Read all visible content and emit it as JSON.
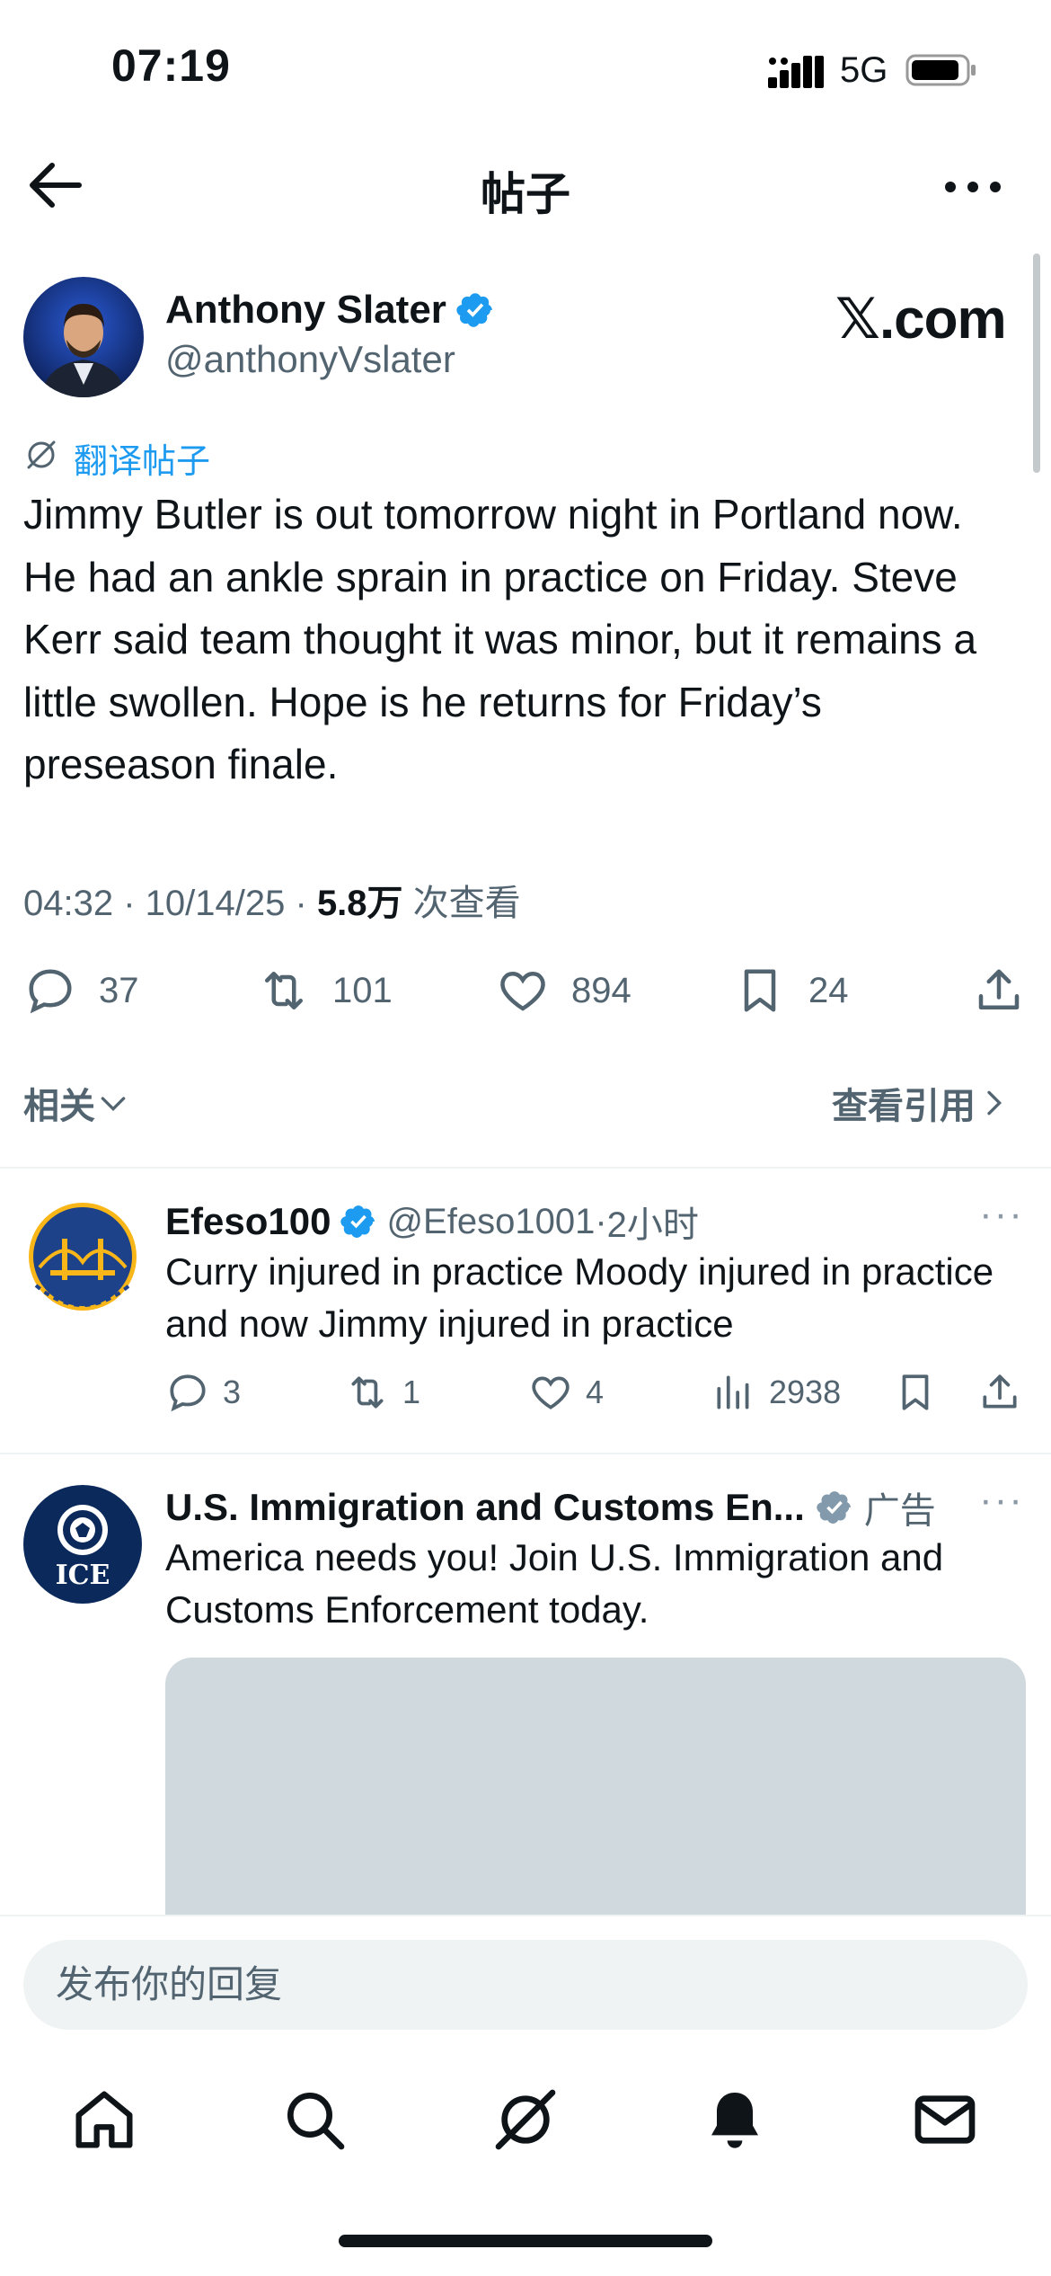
{
  "status_bar": {
    "time": "07:19",
    "network": "5G"
  },
  "nav": {
    "title": "帖子"
  },
  "post": {
    "author_name": "Anthony Slater",
    "author_handle": "@anthonyVslater",
    "watermark": "𝕏.com",
    "translate_label": "翻译帖子",
    "text": "Jimmy Butler is out tomorrow night in Portland now. He had an ankle sprain in practice on Friday. Steve Kerr said team thought it was minor, but it remains a little swollen. Hope is he returns for Friday’s preseason finale.",
    "time": "04:32",
    "date": "10/14/25",
    "views_count": "5.8万",
    "views_label": "次查看",
    "replies": "37",
    "reposts": "101",
    "likes": "894",
    "bookmarks": "24"
  },
  "filters": {
    "related_label": "相关",
    "quotes_label": "查看引用"
  },
  "replies": [
    {
      "name": "Efeso100",
      "handle": "@Efeso1001",
      "time": "2小时",
      "text": "Curry injured in practice Moody injured in practice and now Jimmy injured in practice",
      "replies": "3",
      "reposts": "1",
      "likes": "4",
      "views": "2938"
    }
  ],
  "ad": {
    "name": "U.S. Immigration and Customs En...",
    "ad_label": "广告",
    "avatar_text": "ICE",
    "text": "America needs you! Join U.S. Immigration and Customs Enforcement today."
  },
  "reply_bar": {
    "placeholder": "发布你的回复"
  },
  "tabs": [
    "home",
    "search",
    "grok",
    "notifications",
    "messages"
  ],
  "colors": {
    "accent": "#1d9bf0",
    "text": "#0f1419",
    "secondary": "#536471"
  }
}
